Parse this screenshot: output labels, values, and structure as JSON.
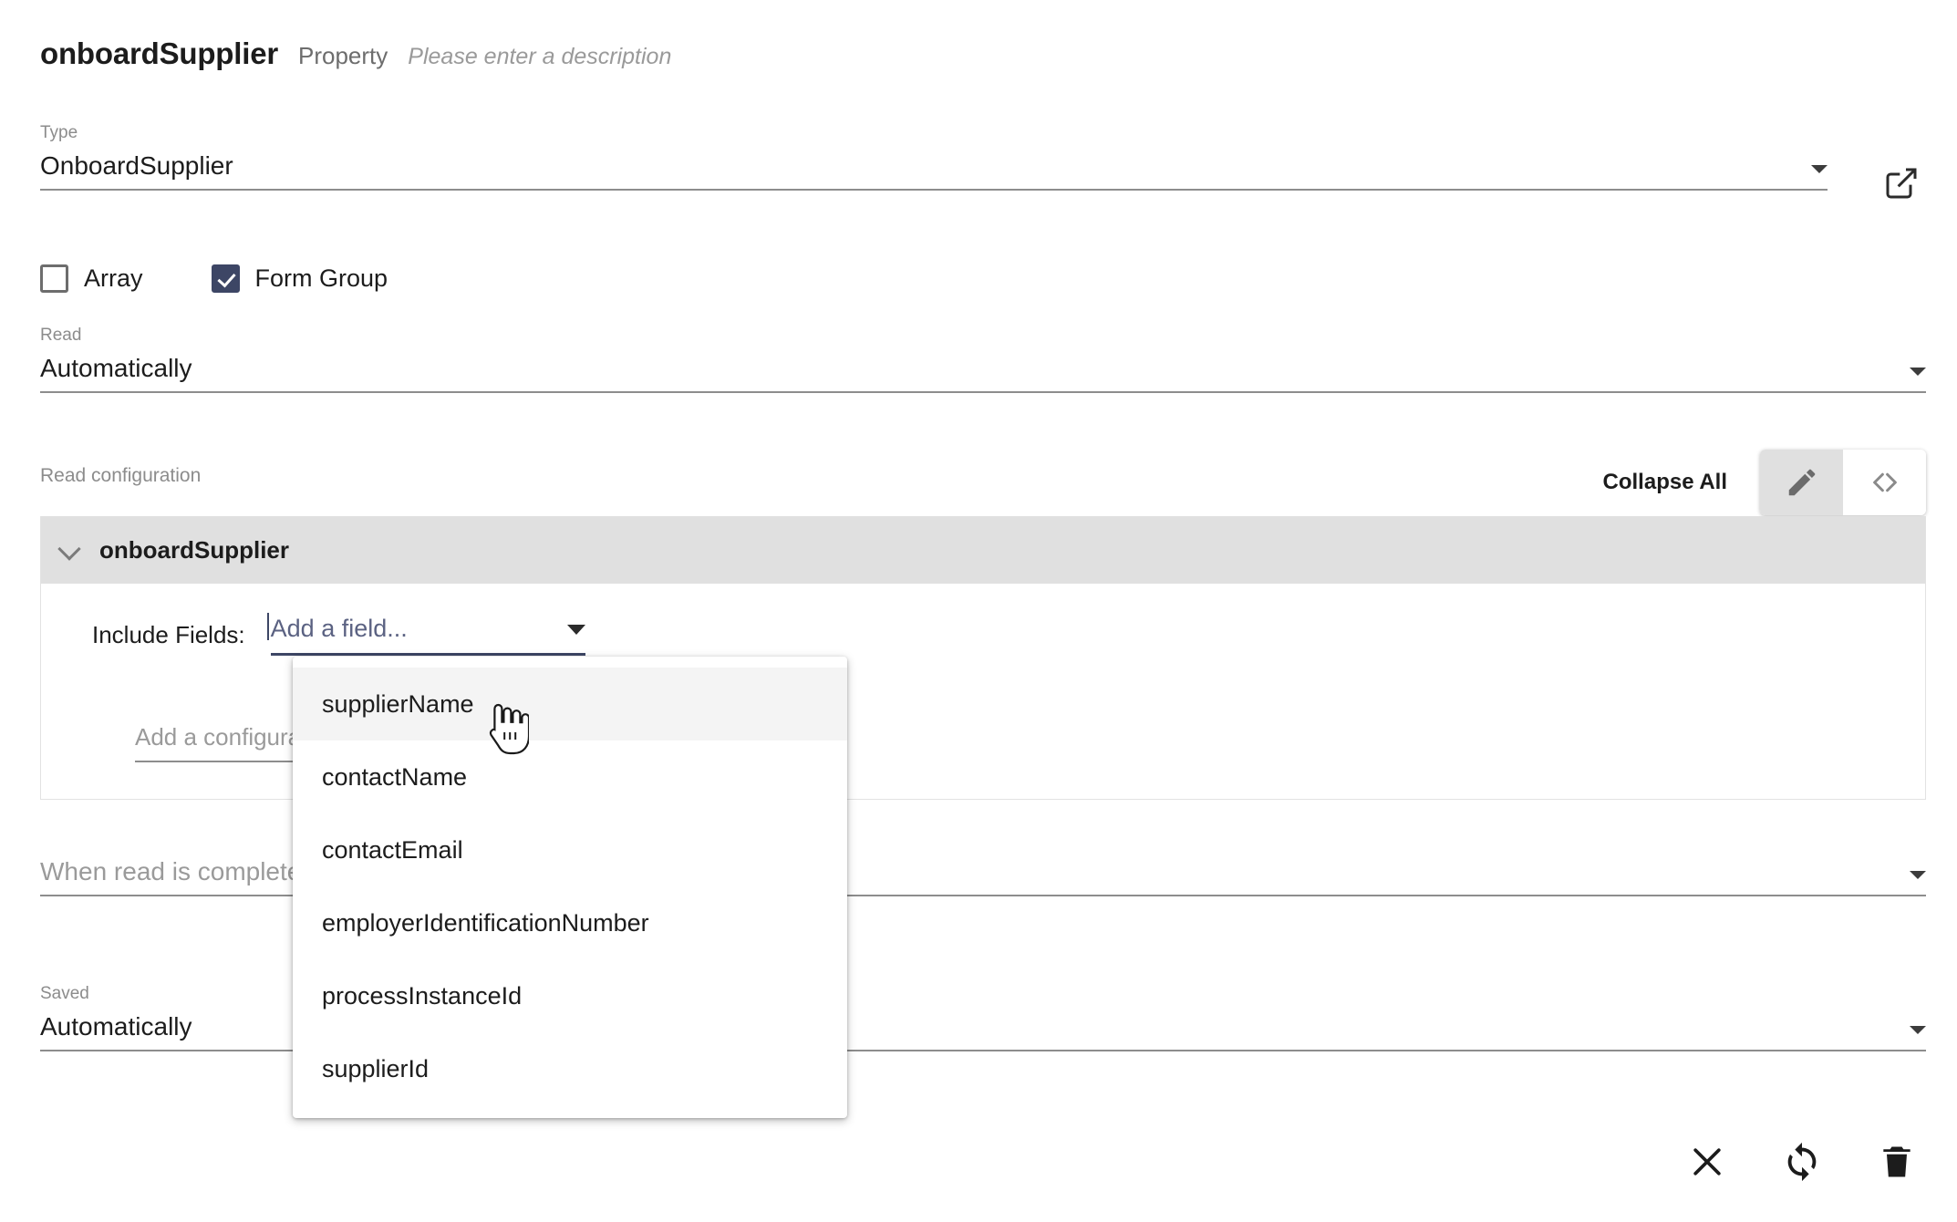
{
  "header": {
    "title": "onboardSupplier",
    "kind": "Property",
    "description_placeholder": "Please enter a description"
  },
  "type_field": {
    "label": "Type",
    "value": "OnboardSupplier",
    "open_external_icon": "external-link-icon",
    "caret_icon": "chevron-down-icon"
  },
  "checkboxes": [
    {
      "label": "Array",
      "checked": false
    },
    {
      "label": "Form Group",
      "checked": true
    }
  ],
  "read_field": {
    "label": "Read",
    "value": "Automatically",
    "caret_icon": "chevron-down-icon"
  },
  "read_configuration": {
    "label": "Read configuration",
    "collapse_all_label": "Collapse All",
    "toggles": [
      {
        "name": "pencil-icon",
        "label": "Edit",
        "active": true
      },
      {
        "name": "code-icon",
        "label": "Code",
        "active": false
      }
    ]
  },
  "panel": {
    "title": "onboardSupplier",
    "chevron_icon": "chevron-down-icon",
    "include_fields_label": "Include Fields:",
    "add_field_placeholder": "Add a field...",
    "add_configuration_placeholder": "Add a configuration"
  },
  "dropdown": {
    "options": [
      "supplierName",
      "contactName",
      "contactEmail",
      "employerIdentificationNumber",
      "processInstanceId",
      "supplierId"
    ],
    "hovered_index": 0
  },
  "when_read_field": {
    "label": "",
    "value": "When read is complete",
    "caret_icon": "chevron-down-icon"
  },
  "saved_field": {
    "label": "Saved",
    "value": "Automatically",
    "caret_icon": "chevron-down-icon"
  },
  "action_bar": [
    {
      "name": "close-icon",
      "label": "Close"
    },
    {
      "name": "sync-icon",
      "label": "Refresh"
    },
    {
      "name": "trash-icon",
      "label": "Delete"
    }
  ],
  "colors": {
    "accent": "#3d4665",
    "panel_header": "#e0e0e0",
    "muted_text": "#8c8c8c",
    "underline": "#8d8d8d"
  }
}
